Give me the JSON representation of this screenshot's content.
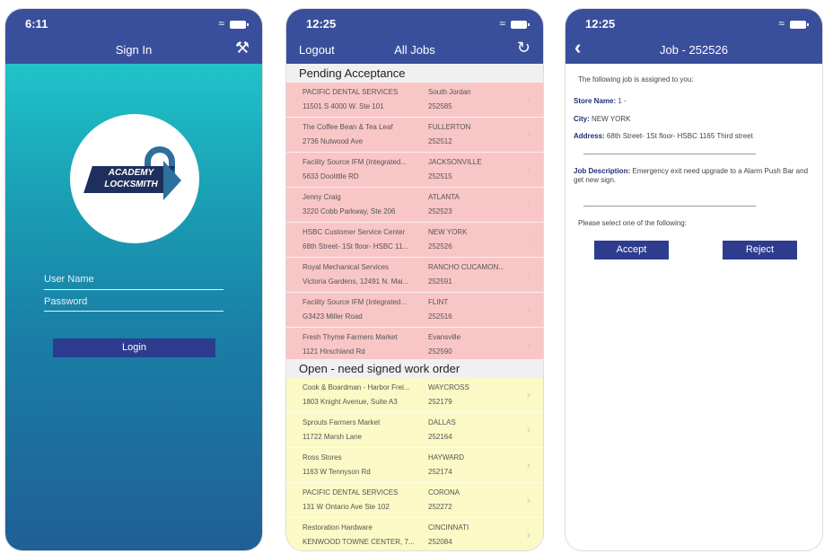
{
  "screens": {
    "signin": {
      "time": "6:11",
      "title": "Sign In",
      "logo_line1": "ACADEMY",
      "logo_line2": "LOCKSMITH",
      "username_label": "User Name",
      "password_label": "Password",
      "login_label": "Login"
    },
    "jobs": {
      "time": "12:25",
      "logout_label": "Logout",
      "title": "All Jobs",
      "sections": [
        {
          "header": "Pending Acceptance",
          "rows": [
            {
              "name": "PACIFIC DENTAL SERVICES",
              "address": "11501 S 4000 W. Ste 101",
              "city": "South Jordan",
              "job": "252585"
            },
            {
              "name": "The Coffee Bean & Tea Leaf",
              "address": "2736 Nutwood Ave",
              "city": "FULLERTON",
              "job": "252512"
            },
            {
              "name": "Facility Source IFM (Integrated...",
              "address": "5633 Doolittle RD",
              "city": "JACKSONVILLE",
              "job": "252515"
            },
            {
              "name": "Jenny Craig",
              "address": "3220 Cobb Parkway, Ste 206",
              "city": "ATLANTA",
              "job": "252523"
            },
            {
              "name": "HSBC Customer Service Center",
              "address": "68th Street- 1St floor- HSBC 11...",
              "city": "NEW YORK",
              "job": "252526"
            },
            {
              "name": "Royal Mechanical Services",
              "address": "Victoria Gardens, 12491 N. Mai...",
              "city": "RANCHO CUCAMON...",
              "job": "252591"
            },
            {
              "name": "Facility Source IFM (Integrated...",
              "address": "G3423 Miller Road",
              "city": "FLINT",
              "job": "252516"
            },
            {
              "name": "Fresh Thyme Farmers Market",
              "address": "1121 Hirschland Rd",
              "city": "Evansville",
              "job": "252590"
            }
          ]
        },
        {
          "header": "Open - need signed work order",
          "rows": [
            {
              "name": "Cook & Boardman - Harbor Frei...",
              "address": "1803 Knight Avenue, Suite A3",
              "city": "WAYCROSS",
              "job": "252179"
            },
            {
              "name": "Sprouts Farmers Market",
              "address": "11722 Marsh Lane",
              "city": "DALLAS",
              "job": "252164"
            },
            {
              "name": "Ross Stores",
              "address": "1163 W Tennyson Rd",
              "city": "HAYWARD",
              "job": "252174"
            },
            {
              "name": "PACIFIC DENTAL SERVICES",
              "address": "131 W Ontario Ave Ste 102",
              "city": "CORONA",
              "job": "252272"
            },
            {
              "name": "Restoration Hardware",
              "address": "KENWOOD TOWNE CENTER, 7...",
              "city": "CINCINNATI",
              "job": "252084"
            }
          ]
        }
      ]
    },
    "job_detail": {
      "time": "12:25",
      "title": "Job - 252526",
      "intro": "The following job is assigned to you:",
      "store_label": "Store Name:",
      "store_value": "1 -",
      "city_label": "City:",
      "city_value": "NEW YORK",
      "address_label": "Address:",
      "address_value": "68th Street- 1St floor- HSBC 1165 Third street",
      "description_label": "Job Description:",
      "description_value": "Emergency exit need upgrade to a Alarm Push Bar and get new sign.",
      "select_prompt": "Please select one of the following:",
      "accept_label": "Accept",
      "reject_label": "Reject"
    }
  },
  "colors": {
    "nav": "#3a4f9c",
    "button": "#2e3c8f",
    "pending_row": "#f9c6c6",
    "open_row": "#fbf9c6"
  },
  "icons": [
    "wifi-icon",
    "battery-icon",
    "tools-icon",
    "refresh-icon",
    "back-icon",
    "chevron-right-icon"
  ]
}
